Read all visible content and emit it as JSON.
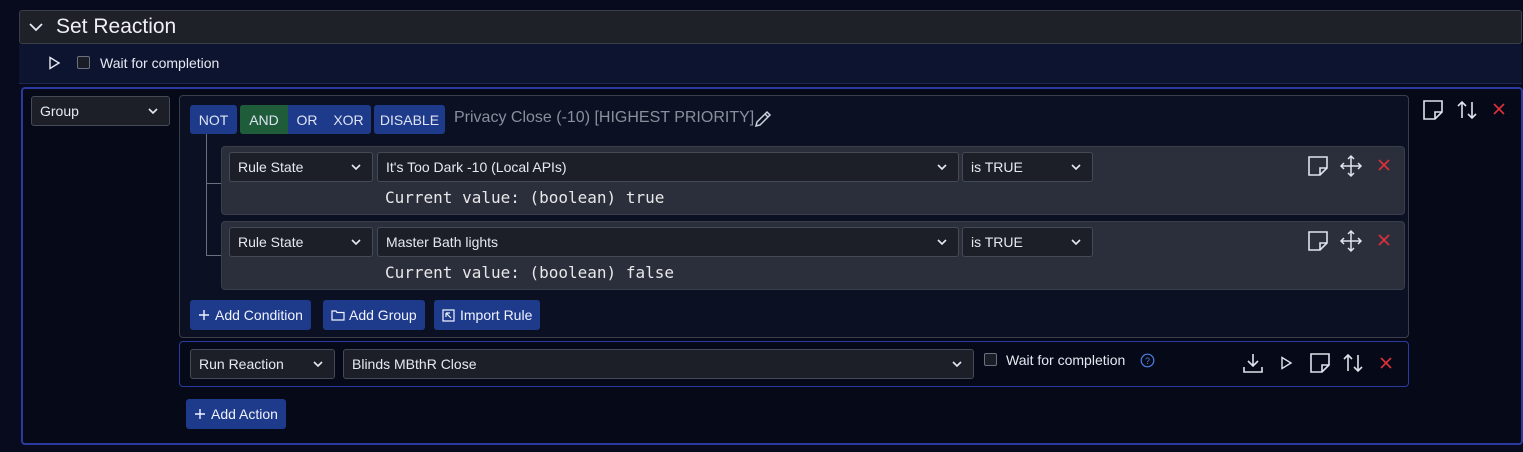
{
  "header": {
    "title": "Set Reaction"
  },
  "subbar": {
    "wait_label": "Wait for completion"
  },
  "group_select": {
    "value": "Group"
  },
  "logic": {
    "not": "NOT",
    "and": "AND",
    "or": "OR",
    "xor": "XOR",
    "disable": "DISABLE"
  },
  "group": {
    "title": "Privacy Close (-10) [HIGHEST PRIORITY]"
  },
  "conditions": [
    {
      "type": "Rule State",
      "target": "It's Too Dark -10 (Local APIs)",
      "operator": "is TRUE",
      "current": "Current value: (boolean) true"
    },
    {
      "type": "Rule State",
      "target": "Master Bath lights",
      "operator": "is TRUE",
      "current": "Current value: (boolean) false"
    }
  ],
  "group_actions": {
    "add_condition": "Add Condition",
    "add_group": "Add Group",
    "import_rule": "Import Rule"
  },
  "reaction": {
    "type": "Run Reaction",
    "target": "Blinds MBthR Close",
    "wait_label": "Wait for completion"
  },
  "footer": {
    "add_action": "Add Action"
  },
  "colors": {
    "accent": "#1e3a8a",
    "and_active": "#1f5c3a",
    "delete": "#e0303b",
    "border_blue": "#2b3aa0"
  }
}
